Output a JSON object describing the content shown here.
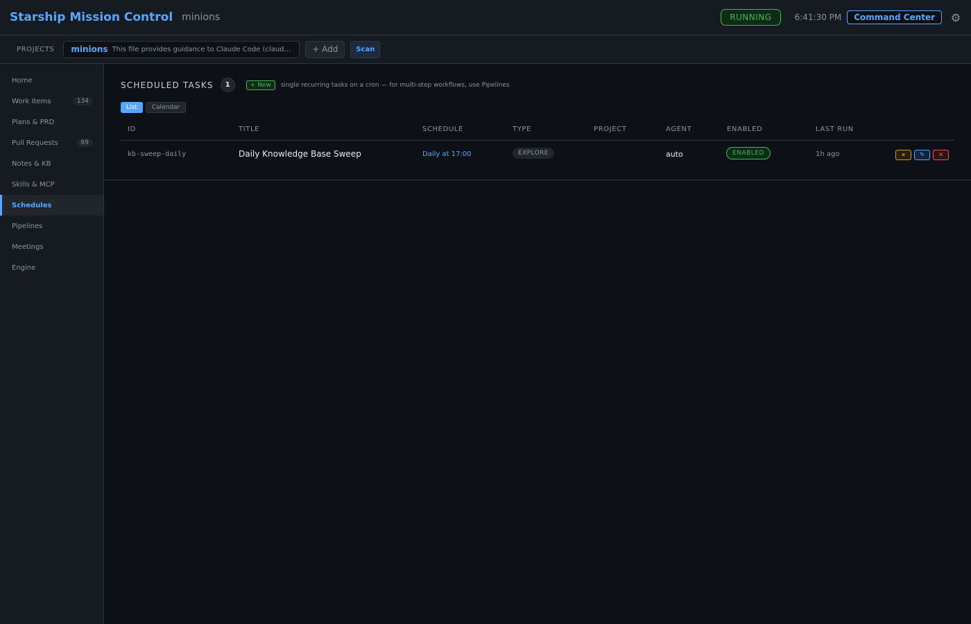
{
  "header": {
    "title": "Starship Mission Control",
    "subtitle": "minions",
    "status": "RUNNING",
    "clock": "6:41:30 PM",
    "command_center": "Command Center",
    "settings_icon": "gear-icon"
  },
  "projects_bar": {
    "label": "PROJECTS",
    "project": {
      "name": "minions",
      "description": "This file provides guidance to Claude Code (claude.ai/code) ..."
    },
    "add_label": "+ Add",
    "scan_label": "Scan"
  },
  "sidebar": {
    "items": [
      {
        "label": "Home",
        "count": ""
      },
      {
        "label": "Work Items",
        "count": "134"
      },
      {
        "label": "Plans & PRD",
        "count": ""
      },
      {
        "label": "Pull Requests",
        "count": "69"
      },
      {
        "label": "Notes & KB",
        "count": ""
      },
      {
        "label": "Skills & MCP",
        "count": ""
      },
      {
        "label": "Schedules",
        "count": ""
      },
      {
        "label": "Pipelines",
        "count": ""
      },
      {
        "label": "Meetings",
        "count": ""
      },
      {
        "label": "Engine",
        "count": ""
      }
    ],
    "active": "Schedules"
  },
  "main": {
    "title": "SCHEDULED TASKS",
    "count": "1",
    "new_label": "+ New",
    "hint": "single recurring tasks on a cron — for multi-step workflows, use Pipelines",
    "views": {
      "list": "List",
      "calendar": "Calendar"
    },
    "columns": [
      "ID",
      "TITLE",
      "SCHEDULE",
      "TYPE",
      "PROJECT",
      "AGENT",
      "ENABLED",
      "LAST RUN"
    ],
    "rows": [
      {
        "id": "kb-sweep-daily",
        "title": "Daily Knowledge Base Sweep",
        "schedule": "Daily at 17:00",
        "type": "EXPLORE",
        "project": "",
        "agent": "auto",
        "enabled": "ENABLED",
        "last_run": "1h ago",
        "actions": {
          "pause": "⏸",
          "edit": "✎",
          "delete": "✕"
        }
      }
    ]
  },
  "colors": {
    "background": "#0d1117",
    "panel": "#161b22",
    "accent": "#58a6ff",
    "success": "#3fb950",
    "warning": "#d29922",
    "danger": "#f85149"
  }
}
